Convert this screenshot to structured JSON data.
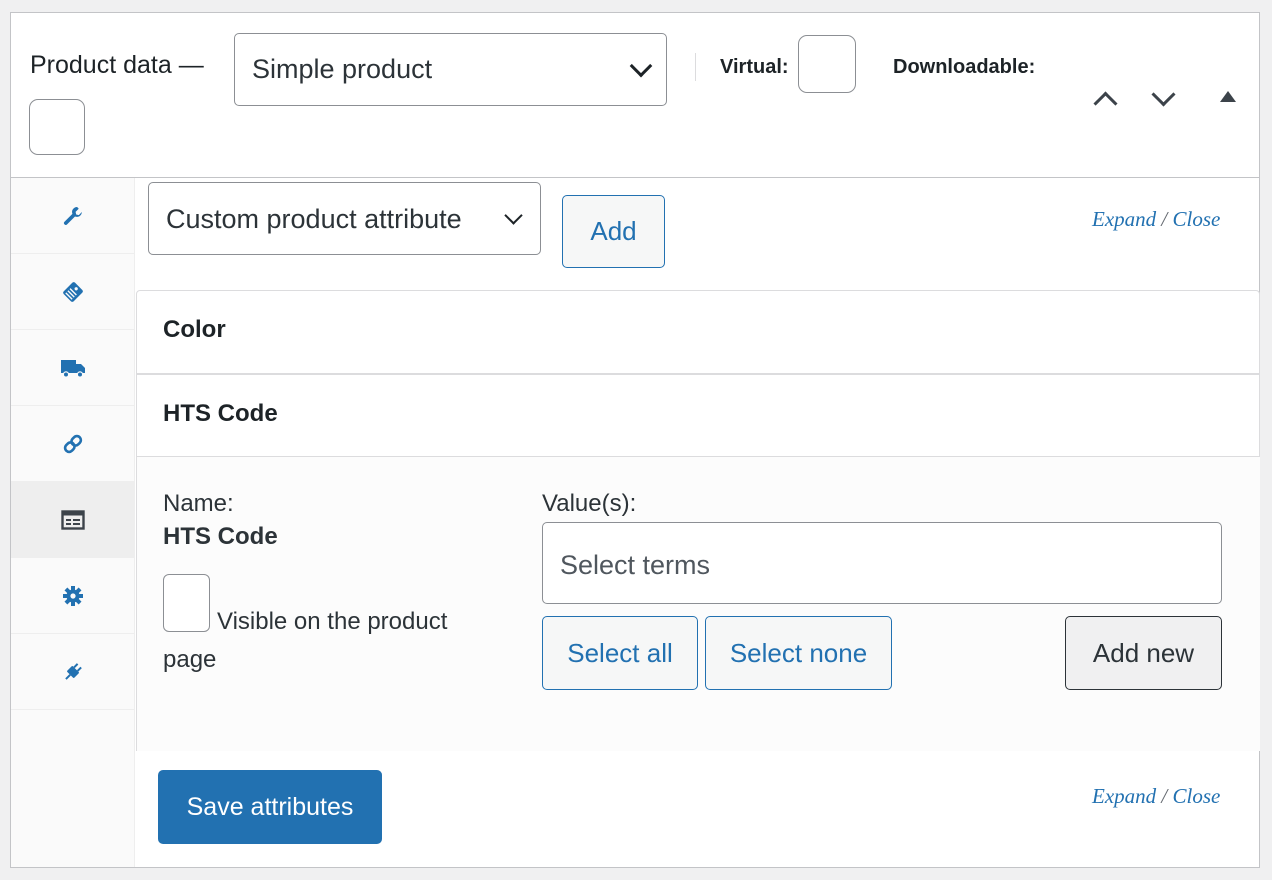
{
  "header": {
    "title": "Product data —",
    "product_type": "Simple product",
    "virtual_label": "Virtual:",
    "downloadable_label": "Downloadable:"
  },
  "sidebar": {
    "tabs": [
      {
        "icon": "wrench-icon"
      },
      {
        "icon": "tag-icon"
      },
      {
        "icon": "truck-icon"
      },
      {
        "icon": "link-icon"
      },
      {
        "icon": "attributes-card-icon",
        "active": true
      },
      {
        "icon": "gear-icon"
      },
      {
        "icon": "plug-icon"
      }
    ]
  },
  "toolbar": {
    "attribute_select": "Custom product attribute",
    "add_label": "Add",
    "expand_label": "Expand",
    "separator": "/",
    "close_label": "Close"
  },
  "attributes": [
    {
      "name": "Color"
    },
    {
      "name": "HTS Code"
    }
  ],
  "attribute_detail": {
    "name_label": "Name:",
    "name_value": "HTS Code",
    "visible_label": "Visible on the product page",
    "values_label": "Value(s):",
    "terms_placeholder": "Select terms",
    "select_all": "Select all",
    "select_none": "Select none",
    "add_new": "Add new"
  },
  "footer": {
    "save_label": "Save attributes",
    "expand_label": "Expand",
    "separator": "/",
    "close_label": "Close"
  },
  "colors": {
    "primary": "#2271b1",
    "border": "#c3c4c7"
  }
}
